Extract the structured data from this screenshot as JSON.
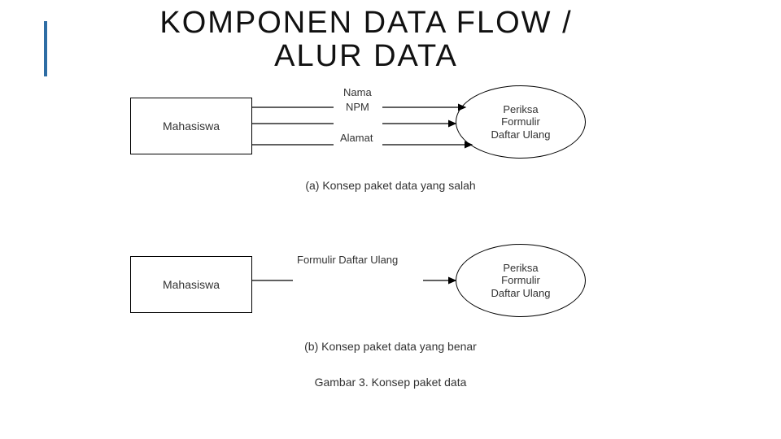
{
  "title_line1": "KOMPONEN DATA FLOW /",
  "title_line2": "ALUR DATA",
  "diagram_a": {
    "entity": "Mahasiswa",
    "flows": {
      "top": "Nama",
      "mid": "NPM",
      "bot": "Alamat"
    },
    "process": {
      "l1": "Periksa",
      "l2": "Formulir",
      "l3": "Daftar Ulang"
    },
    "caption": "(a) Konsep paket data yang salah"
  },
  "diagram_b": {
    "entity": "Mahasiswa",
    "flow": "Formulir Daftar Ulang",
    "process": {
      "l1": "Periksa",
      "l2": "Formulir",
      "l3": "Daftar Ulang"
    },
    "caption": "(b) Konsep paket data yang benar"
  },
  "figure_caption": "Gambar 3. Konsep paket data"
}
